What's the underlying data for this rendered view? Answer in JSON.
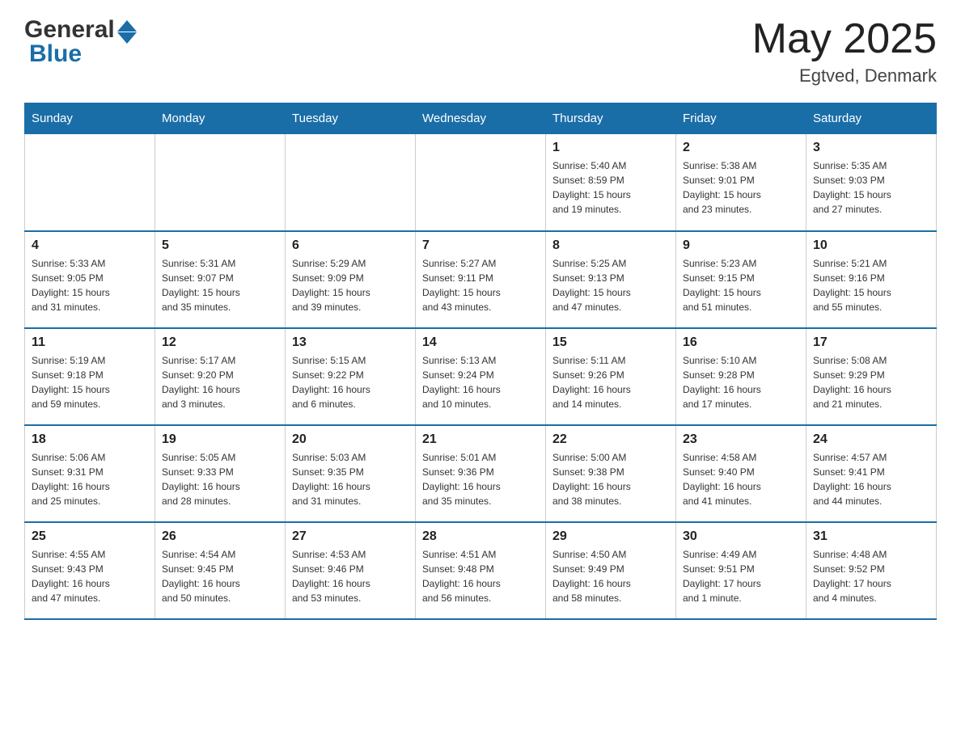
{
  "header": {
    "logo_general": "General",
    "logo_blue": "Blue",
    "month_title": "May 2025",
    "location": "Egtved, Denmark"
  },
  "weekdays": [
    "Sunday",
    "Monday",
    "Tuesday",
    "Wednesday",
    "Thursday",
    "Friday",
    "Saturday"
  ],
  "weeks": [
    [
      {
        "day": "",
        "info": ""
      },
      {
        "day": "",
        "info": ""
      },
      {
        "day": "",
        "info": ""
      },
      {
        "day": "",
        "info": ""
      },
      {
        "day": "1",
        "info": "Sunrise: 5:40 AM\nSunset: 8:59 PM\nDaylight: 15 hours\nand 19 minutes."
      },
      {
        "day": "2",
        "info": "Sunrise: 5:38 AM\nSunset: 9:01 PM\nDaylight: 15 hours\nand 23 minutes."
      },
      {
        "day": "3",
        "info": "Sunrise: 5:35 AM\nSunset: 9:03 PM\nDaylight: 15 hours\nand 27 minutes."
      }
    ],
    [
      {
        "day": "4",
        "info": "Sunrise: 5:33 AM\nSunset: 9:05 PM\nDaylight: 15 hours\nand 31 minutes."
      },
      {
        "day": "5",
        "info": "Sunrise: 5:31 AM\nSunset: 9:07 PM\nDaylight: 15 hours\nand 35 minutes."
      },
      {
        "day": "6",
        "info": "Sunrise: 5:29 AM\nSunset: 9:09 PM\nDaylight: 15 hours\nand 39 minutes."
      },
      {
        "day": "7",
        "info": "Sunrise: 5:27 AM\nSunset: 9:11 PM\nDaylight: 15 hours\nand 43 minutes."
      },
      {
        "day": "8",
        "info": "Sunrise: 5:25 AM\nSunset: 9:13 PM\nDaylight: 15 hours\nand 47 minutes."
      },
      {
        "day": "9",
        "info": "Sunrise: 5:23 AM\nSunset: 9:15 PM\nDaylight: 15 hours\nand 51 minutes."
      },
      {
        "day": "10",
        "info": "Sunrise: 5:21 AM\nSunset: 9:16 PM\nDaylight: 15 hours\nand 55 minutes."
      }
    ],
    [
      {
        "day": "11",
        "info": "Sunrise: 5:19 AM\nSunset: 9:18 PM\nDaylight: 15 hours\nand 59 minutes."
      },
      {
        "day": "12",
        "info": "Sunrise: 5:17 AM\nSunset: 9:20 PM\nDaylight: 16 hours\nand 3 minutes."
      },
      {
        "day": "13",
        "info": "Sunrise: 5:15 AM\nSunset: 9:22 PM\nDaylight: 16 hours\nand 6 minutes."
      },
      {
        "day": "14",
        "info": "Sunrise: 5:13 AM\nSunset: 9:24 PM\nDaylight: 16 hours\nand 10 minutes."
      },
      {
        "day": "15",
        "info": "Sunrise: 5:11 AM\nSunset: 9:26 PM\nDaylight: 16 hours\nand 14 minutes."
      },
      {
        "day": "16",
        "info": "Sunrise: 5:10 AM\nSunset: 9:28 PM\nDaylight: 16 hours\nand 17 minutes."
      },
      {
        "day": "17",
        "info": "Sunrise: 5:08 AM\nSunset: 9:29 PM\nDaylight: 16 hours\nand 21 minutes."
      }
    ],
    [
      {
        "day": "18",
        "info": "Sunrise: 5:06 AM\nSunset: 9:31 PM\nDaylight: 16 hours\nand 25 minutes."
      },
      {
        "day": "19",
        "info": "Sunrise: 5:05 AM\nSunset: 9:33 PM\nDaylight: 16 hours\nand 28 minutes."
      },
      {
        "day": "20",
        "info": "Sunrise: 5:03 AM\nSunset: 9:35 PM\nDaylight: 16 hours\nand 31 minutes."
      },
      {
        "day": "21",
        "info": "Sunrise: 5:01 AM\nSunset: 9:36 PM\nDaylight: 16 hours\nand 35 minutes."
      },
      {
        "day": "22",
        "info": "Sunrise: 5:00 AM\nSunset: 9:38 PM\nDaylight: 16 hours\nand 38 minutes."
      },
      {
        "day": "23",
        "info": "Sunrise: 4:58 AM\nSunset: 9:40 PM\nDaylight: 16 hours\nand 41 minutes."
      },
      {
        "day": "24",
        "info": "Sunrise: 4:57 AM\nSunset: 9:41 PM\nDaylight: 16 hours\nand 44 minutes."
      }
    ],
    [
      {
        "day": "25",
        "info": "Sunrise: 4:55 AM\nSunset: 9:43 PM\nDaylight: 16 hours\nand 47 minutes."
      },
      {
        "day": "26",
        "info": "Sunrise: 4:54 AM\nSunset: 9:45 PM\nDaylight: 16 hours\nand 50 minutes."
      },
      {
        "day": "27",
        "info": "Sunrise: 4:53 AM\nSunset: 9:46 PM\nDaylight: 16 hours\nand 53 minutes."
      },
      {
        "day": "28",
        "info": "Sunrise: 4:51 AM\nSunset: 9:48 PM\nDaylight: 16 hours\nand 56 minutes."
      },
      {
        "day": "29",
        "info": "Sunrise: 4:50 AM\nSunset: 9:49 PM\nDaylight: 16 hours\nand 58 minutes."
      },
      {
        "day": "30",
        "info": "Sunrise: 4:49 AM\nSunset: 9:51 PM\nDaylight: 17 hours\nand 1 minute."
      },
      {
        "day": "31",
        "info": "Sunrise: 4:48 AM\nSunset: 9:52 PM\nDaylight: 17 hours\nand 4 minutes."
      }
    ]
  ]
}
